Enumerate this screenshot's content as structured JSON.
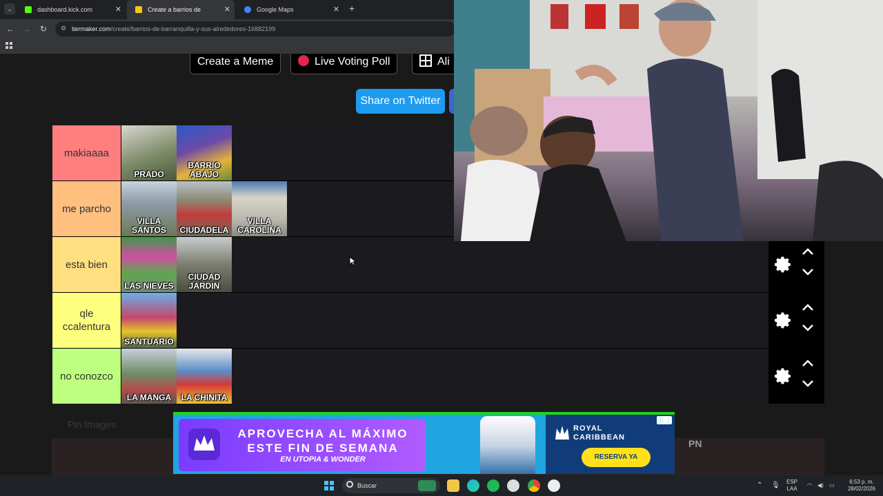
{
  "browser": {
    "tabs": [
      {
        "title": "dashboard.kick.com",
        "fav_color": "#53fc18"
      },
      {
        "title": "Create a barrios de barranquilla",
        "fav_color": "#f5c518"
      },
      {
        "title": "Google Maps",
        "fav_color": "#4285f4"
      }
    ],
    "url_domain": "tiermaker.com",
    "url_path": "/create/barrios-de-barranquilla-y-sus-alrededores-16882199"
  },
  "page": {
    "buttons": {
      "create_meme": "Create a Meme",
      "live_poll": "Live Voting Poll",
      "align": "Ali",
      "share_twitter": "Share on Twitter"
    },
    "pin_label": "Pin Images",
    "tiers": [
      {
        "label": "makiaaaa",
        "color": "#ff7f7f",
        "items": [
          {
            "caption": "PRADO",
            "bg": "#7f8c6a"
          },
          {
            "caption": "BARRIO ABAJO",
            "bg": "#6d4aa8"
          }
        ]
      },
      {
        "label": "me parcho",
        "color": "#ffbf7f",
        "items": [
          {
            "caption": "VILLA SANTOS",
            "bg": "#8e9aa8"
          },
          {
            "caption": "CIUDADELA",
            "bg": "#8a8a72"
          },
          {
            "caption": "VILLA CAROLINA",
            "bg": "#b9b6ae"
          }
        ]
      },
      {
        "label": "esta bien",
        "color": "#ffdf7f",
        "items": [
          {
            "caption": "LAS NIEVES",
            "bg": "#5fa64f"
          },
          {
            "caption": "CIUDAD JARDIN",
            "bg": "#7b7d6e"
          }
        ]
      },
      {
        "label": "qle ccalentura",
        "color": "#ffff7f",
        "items": [
          {
            "caption": "SANTUARIO",
            "bg": "#c3476e"
          }
        ]
      },
      {
        "label": "no conozco",
        "color": "#bfff7f",
        "items": [
          {
            "caption": "LA MANGA",
            "bg": "#6f8c6a"
          },
          {
            "caption": "LA CHINITA",
            "bg": "#5a8fc9"
          }
        ]
      }
    ]
  },
  "ad": {
    "headline": "APROVECHA AL MÁXIMO ESTE FIN DE SEMANA",
    "sub": "EN UTOPIA & WONDER",
    "brand": "ROYAL CARIBBEAN",
    "cta": "RESERVA YA"
  },
  "overlay_text": "PN",
  "taskbar": {
    "search": "Buscar",
    "lang_line1": "ESP",
    "lang_line2": "LAA",
    "time": "6:53 p. m.",
    "date": "28/02/2026"
  }
}
